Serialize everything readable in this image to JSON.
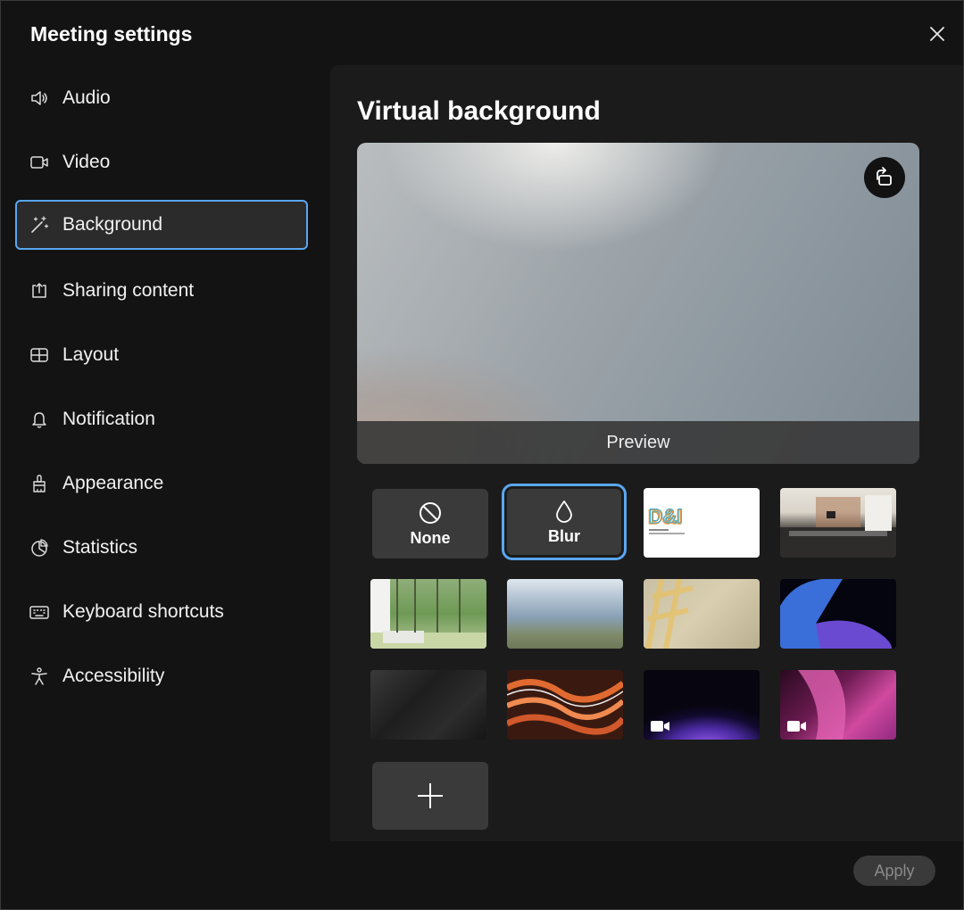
{
  "window": {
    "title": "Meeting settings"
  },
  "sidebar": {
    "items": [
      {
        "label": "Audio",
        "icon": "speaker-icon"
      },
      {
        "label": "Video",
        "icon": "video-camera-icon"
      },
      {
        "label": "Background",
        "icon": "magic-wand-icon",
        "active": true
      },
      {
        "label": "Sharing content",
        "icon": "share-upload-icon"
      },
      {
        "label": "Layout",
        "icon": "layout-grid-icon"
      },
      {
        "label": "Notification",
        "icon": "bell-icon"
      },
      {
        "label": "Appearance",
        "icon": "paint-brush-icon"
      },
      {
        "label": "Statistics",
        "icon": "pie-chart-icon"
      },
      {
        "label": "Keyboard shortcuts",
        "icon": "keyboard-icon"
      },
      {
        "label": "Accessibility",
        "icon": "accessibility-person-icon"
      }
    ]
  },
  "main": {
    "title": "Virtual background",
    "preview_label": "Preview",
    "options": {
      "none_label": "None",
      "blur_label": "Blur",
      "selected": "Blur"
    },
    "apply_label": "Apply"
  },
  "colors": {
    "accent": "#5aa6f0",
    "window_bg": "#131313",
    "panel_bg": "#1b1b1b"
  }
}
